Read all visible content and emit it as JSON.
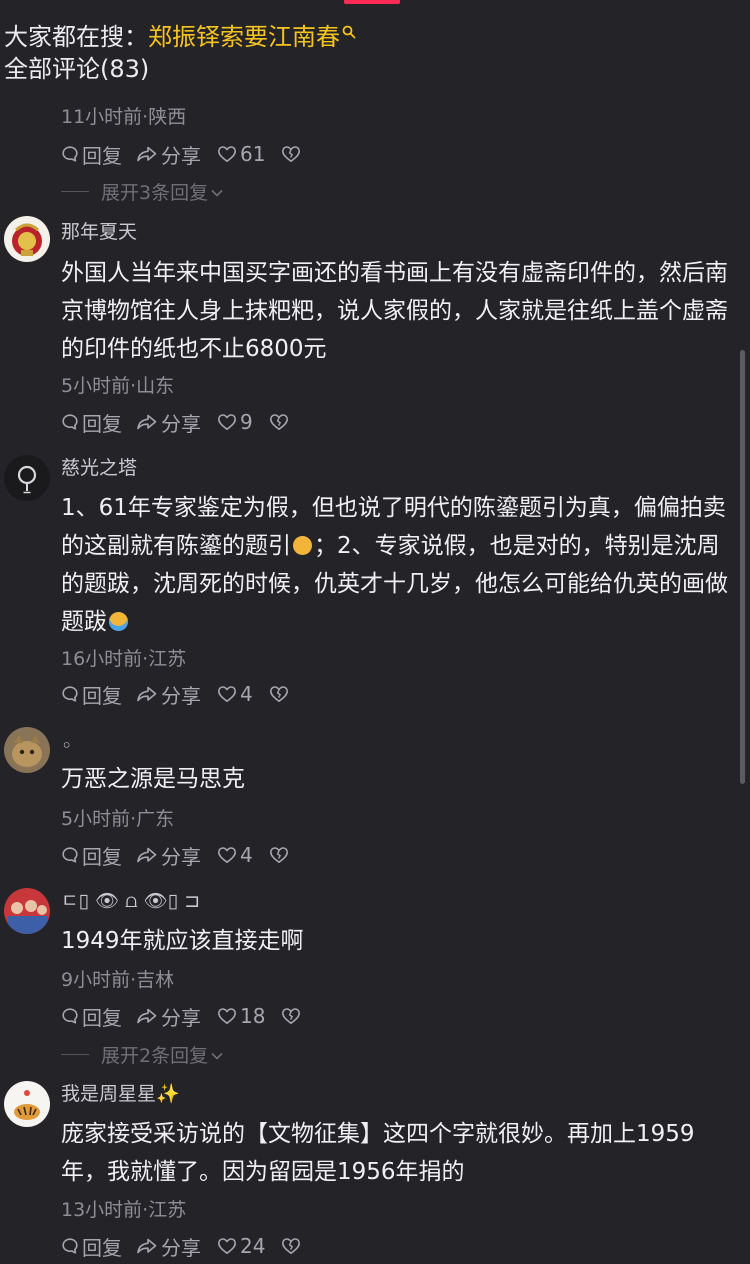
{
  "search_hint": {
    "prefix": "大家都在搜：",
    "keyword": "郑振铎索要江南春"
  },
  "comments_count_title": "全部评论(83)",
  "colors": {
    "background": "#242328",
    "keyword": "#f5c41f",
    "accent": "#ff2a55",
    "muted": "#8e8e95"
  },
  "icons": {
    "reply": "comment-bubble-icon",
    "share": "share-arrow-icon",
    "like": "heart-icon",
    "dislike": "broken-heart-icon",
    "expand": "chevron-down-icon",
    "search": "search-icon"
  },
  "action_labels": {
    "reply": "回复",
    "share": "分享"
  },
  "first_comment": {
    "meta": "11小时前·陕西",
    "likes": "61",
    "expand_label": "展开3条回复"
  },
  "comments": [
    {
      "author": "那年夏天",
      "text": "外国人当年来中国买字画还的看书画上有没有虚斋印件的，然后南京博物馆往人身上抹粑粑，说人家假的，人家就是往纸上盖个虚斋的印件的纸也不止6800元",
      "meta": "5小时前·山东",
      "likes": "9"
    },
    {
      "author": "慈光之塔",
      "text_a": "1、61年专家鉴定为假，但也说了明代的陈鎏题引为真，偏偏拍卖的这副就有陈鎏的题引",
      "text_b": "；2、专家说假，也是对的，特别是沈周的题跋，沈周死的时候，仇英才十几岁，他怎么可能给仇英的画做题跋",
      "meta": "16小时前·江苏",
      "likes": "4"
    },
    {
      "author": "◦",
      "text": "万恶之源是马思克",
      "meta": "5小时前·广东",
      "likes": "4"
    },
    {
      "author": "ㄷ▯ 👁 ⩍ 👁▯ ⊐",
      "text": "1949年就应该直接走啊",
      "meta": "9小时前·吉林",
      "likes": "18",
      "expand_label": "展开2条回复"
    },
    {
      "author": "我是周星星✨",
      "text": "庞家接受采访说的【文物征集】这四个字就很妙。再加上1959年，我就懂了。因为留园是1956年捐的",
      "meta": "13小时前·江苏",
      "likes": "24"
    }
  ]
}
